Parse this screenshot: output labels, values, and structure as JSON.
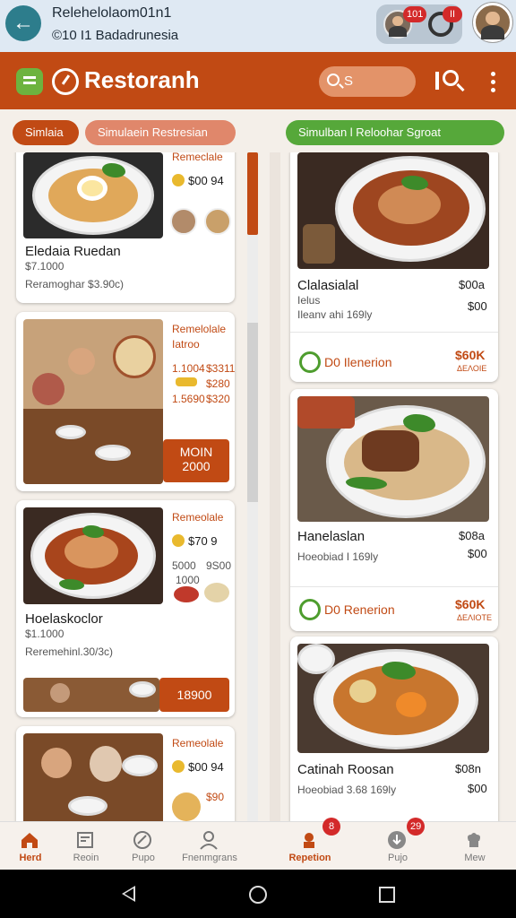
{
  "call_bar": {
    "title": "Relehelolaom01n1",
    "subtitle": "©10 I1 Badadrunesia",
    "badge_1": "101",
    "badge_2": "II"
  },
  "header": {
    "title": "Restoranh",
    "search_text": "S"
  },
  "filters": {
    "chip_1": "Simlaia",
    "chip_2": "Simulaein Restresian",
    "chip_3": "Simulban l Reloohar Sgroat"
  },
  "left_cards": [
    {
      "tag": "Remeclale",
      "price": "$00 94",
      "name": "Eledaia Ruedan",
      "meta_1": "$7.1000",
      "meta_2": "Reramoghar $3.90c)"
    },
    {
      "tag_1": "Remelolale",
      "tag_2": "Iatroo",
      "row_1_a": "1.1004",
      "row_1_b": "$3311",
      "row_2_b": "$280",
      "row_3_a": "1.5690",
      "row_3_b": "$320",
      "cta_1": "MOIN",
      "cta_2": "2000"
    },
    {
      "tag": "Remeolale",
      "price": "$70 9",
      "row_1_a": "5000",
      "row_1_b": "9S00",
      "row_2_a": "1000",
      "name": "Hoelaskoclor",
      "meta_1": "$1.1000",
      "meta_2": "Reremehinl.30/3c)",
      "cta": "18900"
    },
    {
      "tag": "Remeolale",
      "price": "$00 94",
      "price_2": "$90"
    }
  ],
  "right_cards": [
    {
      "name": "Clalasialal",
      "price_1": "$00a",
      "meta_1": "Ielus",
      "meta_2": "Ileanv ahi 169ly",
      "price_2": "$00",
      "deal": "D0 Ilenerion",
      "deal_price": "$60K",
      "deal_sub": "ΔΕΛΟΙΕ"
    },
    {
      "name": "Hanelaslan",
      "price_1": "$08a",
      "meta": "Hoeobiad I 169ly",
      "price_2": "$00",
      "deal": "D0 Renerion",
      "deal_price": "$60K",
      "deal_sub": "ΔΕΛΙΟΤΕ"
    },
    {
      "name": "Catinah Roosan",
      "price_1": "$08n",
      "meta": "Hoeobiad 3.68 169ly",
      "price_2": "$00"
    }
  ],
  "bottom_nav": {
    "items": [
      "Herd",
      "Reoin",
      "Pupo",
      "Fnenmgrans",
      "Repetion",
      "Pujo",
      "Mew"
    ],
    "badge_1": "8",
    "badge_2": "29"
  },
  "colors": {
    "primary": "#c14a14",
    "accent_green": "#56a83a",
    "badge_red": "#d32a2a"
  }
}
